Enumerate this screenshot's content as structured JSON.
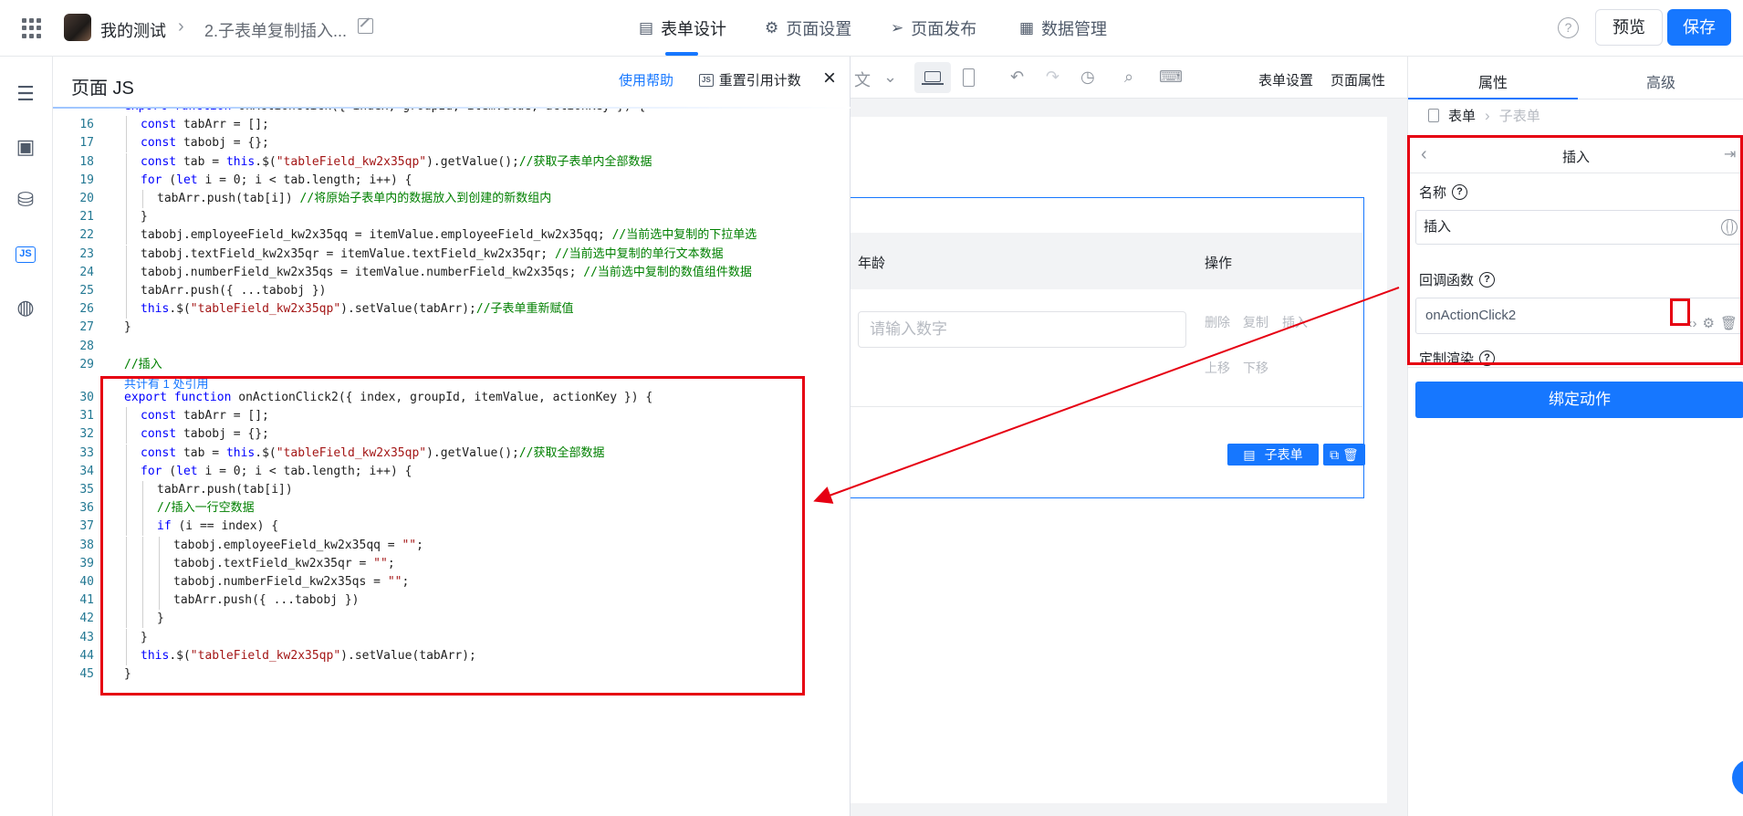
{
  "topbar": {
    "app_title": "我的测试",
    "page_title": "2.子表单复制插入...",
    "tabs": [
      {
        "label": "表单设计",
        "icon": "document-icon",
        "active": true
      },
      {
        "label": "页面设置",
        "icon": "gear-icon",
        "active": false
      },
      {
        "label": "页面发布",
        "icon": "send-icon",
        "active": false
      },
      {
        "label": "数据管理",
        "icon": "table-icon",
        "active": false
      }
    ],
    "help_glyph": "?",
    "preview_label": "预览",
    "save_label": "保存"
  },
  "leftrail": {
    "items": [
      {
        "name": "outline-icon"
      },
      {
        "name": "components-icon"
      },
      {
        "name": "datasource-icon"
      },
      {
        "name": "js-icon",
        "label": "JS",
        "active": true
      },
      {
        "name": "globe-icon"
      }
    ]
  },
  "jspanel": {
    "title": "页面 JS",
    "help_link": "使用帮助",
    "reset_badge": "JS",
    "reset_label": "重置引用计数",
    "close_glyph": "×",
    "ref_hint": "共计有 1 处引用",
    "lines": [
      {
        "n": "",
        "indent": 0,
        "html": "<span class=\"kw\">export</span> <span class=\"kw\">function</span> onActionClick({ index, groupId, itemValue, actionKey }) {"
      },
      {
        "n": "16",
        "indent": 1,
        "html": "<span class=\"kw\">const</span> tabArr = [];"
      },
      {
        "n": "17",
        "indent": 1,
        "html": "<span class=\"kw\">const</span> tabobj = {};"
      },
      {
        "n": "18",
        "indent": 1,
        "html": "<span class=\"kw\">const</span> tab = <span class=\"kw\">this</span>.$(<span class=\"str\">\"tableField_kw2x35qp\"</span>).getValue();<span class=\"cm\">//获取子表单内全部数据</span>"
      },
      {
        "n": "19",
        "indent": 1,
        "html": "<span class=\"kw\">for</span> (<span class=\"kw\">let</span> i = 0; i &lt; tab.length; i++) {"
      },
      {
        "n": "20",
        "indent": 2,
        "html": "tabArr.push(tab[i]) <span class=\"cm\">//将原始子表单内的数据放入到创建的新数组内</span>"
      },
      {
        "n": "21",
        "indent": 1,
        "html": "}"
      },
      {
        "n": "22",
        "indent": 1,
        "html": "tabobj.employeeField_kw2x35qq = itemValue.employeeField_kw2x35qq; <span class=\"cm\">//当前选中复制的下拉单选</span>"
      },
      {
        "n": "23",
        "indent": 1,
        "html": "tabobj.textField_kw2x35qr = itemValue.textField_kw2x35qr; <span class=\"cm\">//当前选中复制的单行文本数据</span>"
      },
      {
        "n": "24",
        "indent": 1,
        "html": "tabobj.numberField_kw2x35qs = itemValue.numberField_kw2x35qs; <span class=\"cm\">//当前选中复制的数值组件数据</span>"
      },
      {
        "n": "25",
        "indent": 1,
        "html": "tabArr.push({ ...tabobj })"
      },
      {
        "n": "26",
        "indent": 1,
        "html": "<span class=\"kw\">this</span>.$(<span class=\"str\">\"tableField_kw2x35qp\"</span>).setValue(tabArr);<span class=\"cm\">//子表单重新赋值</span>"
      },
      {
        "n": "27",
        "indent": 0,
        "html": "}"
      },
      {
        "n": "28",
        "indent": 0,
        "html": ""
      },
      {
        "n": "29",
        "indent": 0,
        "html": "<span class=\"cm\">//插入</span>"
      },
      {
        "n": "30",
        "indent": 0,
        "html": "<span class=\"kw\">export</span> <span class=\"kw\">function</span> onActionClick2({ index, groupId, itemValue, actionKey }) {"
      },
      {
        "n": "31",
        "indent": 1,
        "html": "<span class=\"kw\">const</span> tabArr = [];"
      },
      {
        "n": "32",
        "indent": 1,
        "html": "<span class=\"kw\">const</span> tabobj = {};"
      },
      {
        "n": "33",
        "indent": 1,
        "html": "<span class=\"kw\">const</span> tab = <span class=\"kw\">this</span>.$(<span class=\"str\">\"tableField_kw2x35qp\"</span>).getValue();<span class=\"cm\">//获取全部数据</span>"
      },
      {
        "n": "34",
        "indent": 1,
        "html": "<span class=\"kw\">for</span> (<span class=\"kw\">let</span> i = 0; i &lt; tab.length; i++) {"
      },
      {
        "n": "35",
        "indent": 2,
        "html": "tabArr.push(tab[i])"
      },
      {
        "n": "36",
        "indent": 2,
        "html": "<span class=\"cm\">//插入一行空数据</span>"
      },
      {
        "n": "37",
        "indent": 2,
        "html": "<span class=\"kw\">if</span> (i == index) {"
      },
      {
        "n": "38",
        "indent": 3,
        "html": "tabobj.employeeField_kw2x35qq = <span class=\"str\">\"\"</span>;"
      },
      {
        "n": "39",
        "indent": 3,
        "html": "tabobj.textField_kw2x35qr = <span class=\"str\">\"\"</span>;"
      },
      {
        "n": "40",
        "indent": 3,
        "html": "tabobj.numberField_kw2x35qs = <span class=\"str\">\"\"</span>;"
      },
      {
        "n": "41",
        "indent": 3,
        "html": "tabArr.push({ ...tabobj })"
      },
      {
        "n": "42",
        "indent": 2,
        "html": "}"
      },
      {
        "n": "43",
        "indent": 1,
        "html": "}"
      },
      {
        "n": "44",
        "indent": 1,
        "html": "<span class=\"kw\">this</span>.$(<span class=\"str\">\"tableField_kw2x35qp\"</span>).setValue(tabArr);"
      },
      {
        "n": "45",
        "indent": 0,
        "html": "}"
      }
    ]
  },
  "toolbar": {
    "form_settings": "表单设置",
    "page_props": "页面属性",
    "partial_glyph": "文"
  },
  "subform": {
    "col_age": "年龄",
    "col_actions": "操作",
    "number_placeholder": "请输入数字",
    "row_actions": [
      "删除",
      "复制",
      "插入"
    ],
    "row_actions2": [
      "上移",
      "下移"
    ],
    "tag_label": "子表单"
  },
  "rightpanel": {
    "tab_props": "属性",
    "tab_advanced": "高级",
    "crumb_form": "表单",
    "crumb_subform": "子表单",
    "action_name": "插入",
    "name_label": "名称",
    "name_value": "插入",
    "callback_label": "回调函数",
    "callback_value": "onActionClick2",
    "custom_render_label": "定制渲染",
    "bind_button": "绑定动作"
  },
  "colors": {
    "accent": "#1677ff",
    "annotation": "#e60012"
  }
}
